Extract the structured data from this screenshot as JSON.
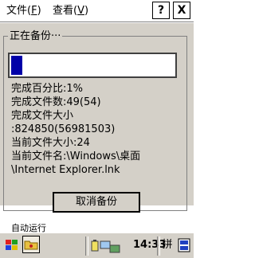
{
  "menubar": {
    "file_label": "文件(",
    "file_key": "F",
    "file_end": ")",
    "view_label": "查看(",
    "view_key": "V",
    "view_end": ")",
    "help_label": "?",
    "close_label": "X"
  },
  "dialog": {
    "title": "正在备份···",
    "progress_percent": 1,
    "lines": [
      "完成百分比:1%",
      "完成文件数:49(54)",
      "完成文件大小",
      ":824850(56981503)",
      "当前文件大小:24",
      "当前文件名:\\Windows\\桌面",
      "\\Internet Explorer.lnk"
    ],
    "cancel_label": "取消备份"
  },
  "background": {
    "autorun_label": "自动运行"
  },
  "taskbar": {
    "clock": "14:33",
    "ime_label": "拼",
    "start_icon": "windows-flag-icon",
    "folder_icon": "folder-icon",
    "tray_icons": [
      "battery-icon",
      "network-icon"
    ],
    "keyboard_icon": "keyboard-icon"
  },
  "colors": {
    "dialog_bg": "#d4d0c8",
    "progress_fill": "#0000a8"
  }
}
